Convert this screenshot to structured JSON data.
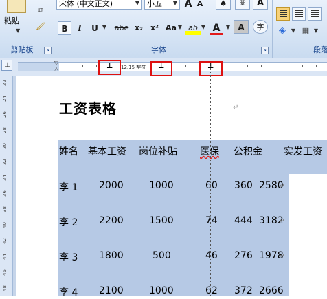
{
  "ribbon": {
    "clipboard": {
      "paste_label": "粘贴",
      "group_label": "剪贴板"
    },
    "font": {
      "font_name": "宋体 (中文正文)",
      "font_size": "小五",
      "grow_label": "A",
      "shrink_label": "A",
      "bold_label": "B",
      "italic_label": "I",
      "underline_label": "U",
      "strike_label": "abe",
      "subscript_label": "x₂",
      "superscript_label": "x²",
      "case_label": "Aa",
      "highlight_label": "ab",
      "color_label": "A",
      "shade_label": "A",
      "enclose_label": "字",
      "group_label": "字体"
    },
    "paragraph": {
      "group_label": "段落"
    }
  },
  "ruler": {
    "tooltip": "12.15 字符"
  },
  "document": {
    "title": "工资表格",
    "table": {
      "headers": [
        "姓名",
        "基本工资",
        "岗位补贴",
        "医保",
        "公积金",
        "实发工资"
      ],
      "rows": [
        [
          "李 1",
          "2000",
          "1000",
          "60",
          "360",
          "2580"
        ],
        [
          "李 2",
          "2200",
          "1500",
          "74",
          "444",
          "3182"
        ],
        [
          "李 3",
          "1800",
          "500",
          "46",
          "276",
          "1978"
        ],
        [
          "李 4",
          "2100",
          "1000",
          "62",
          "372",
          "2666"
        ]
      ]
    }
  },
  "vertical_ruler_numbers": [
    "22",
    "24",
    "26",
    "28",
    "30",
    "32",
    "34",
    "36",
    "38",
    "40",
    "42",
    "44",
    "46",
    "48"
  ],
  "colors": {
    "selection": "#b6c9e5",
    "highlight_box": "#dd1111",
    "ribbon_text": "#15428b"
  }
}
